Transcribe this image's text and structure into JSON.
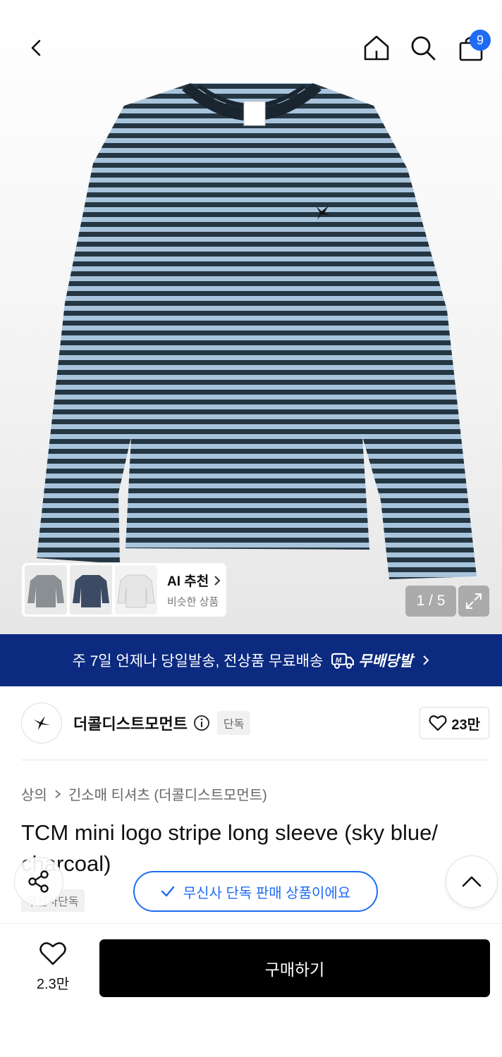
{
  "header": {
    "cart_count": "9"
  },
  "gallery": {
    "counter": "1 / 5",
    "ai": {
      "title": "AI 추천",
      "subtitle": "비슷한 상품"
    }
  },
  "banner": {
    "text": "주 7일 언제나 당일발송, 전상품 무료배송",
    "brand": "무배당발"
  },
  "brand": {
    "name": "더콜디스트모먼트",
    "tag": "단독",
    "likes": "23만"
  },
  "breadcrumb": {
    "category": "상의",
    "subcategory": "긴소매 티셔츠 (더콜디스트모먼트)"
  },
  "product": {
    "title": "TCM mini logo stripe long sleeve (sky blue/ charcoal)",
    "exclusive_label": "무신사단독"
  },
  "toast": {
    "text": "무신사 단독 판매 상품이에요"
  },
  "bottom": {
    "wish_count": "2.3만",
    "buy_label": "구매하기"
  },
  "colors": {
    "banner_bg": "#0b2a80",
    "accent_blue": "#1f6bf5",
    "stripe_light": "#a8c4dc",
    "stripe_dark": "#243642"
  }
}
